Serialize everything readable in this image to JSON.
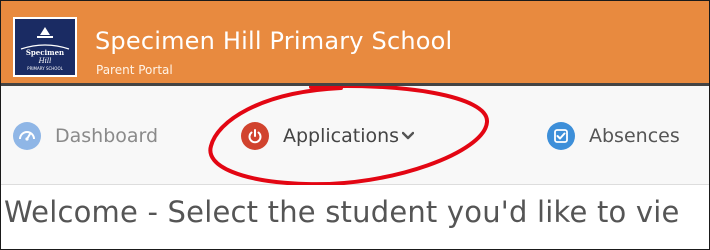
{
  "header": {
    "school_name": "Specimen Hill Primary School",
    "portal_label": "Parent Portal",
    "logo": {
      "text_top": "Specimen",
      "text_mid": "Hill",
      "text_bottom": "PRIMARY SCHOOL"
    },
    "bg_color": "#e88a3f"
  },
  "nav": {
    "items": [
      {
        "label": "Dashboard",
        "icon": "speedometer-icon",
        "color": "#8fb6e6"
      },
      {
        "label": "Applications",
        "icon": "power-icon",
        "color": "#d1432e",
        "has_dropdown": true
      },
      {
        "label": "Absences",
        "icon": "checkbox-icon",
        "color": "#3d8fd9"
      }
    ]
  },
  "main": {
    "welcome_text": "Welcome - Select the student you'd like to vie"
  },
  "annotation": {
    "color": "#e30613",
    "shape": "hand-drawn-oval"
  }
}
